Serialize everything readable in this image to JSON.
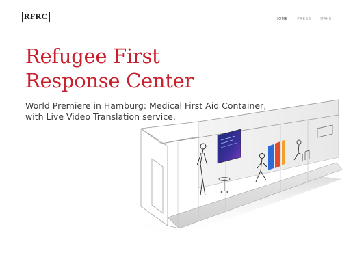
{
  "header": {
    "logo_text": "RFRC",
    "nav": [
      {
        "label": "HOME"
      },
      {
        "label": "PRESS"
      },
      {
        "label": "MAKE"
      }
    ]
  },
  "hero": {
    "title_line1": "Refugee First",
    "title_line2": "Response Center",
    "subtitle_line1": "World Premiere in Hamburg: Medical First Aid Container,",
    "subtitle_line2": "with Live Video Translation service."
  },
  "colors": {
    "accent": "#c8202d",
    "text": "#3a3a3a",
    "nav_inactive": "#9a9a9a"
  }
}
